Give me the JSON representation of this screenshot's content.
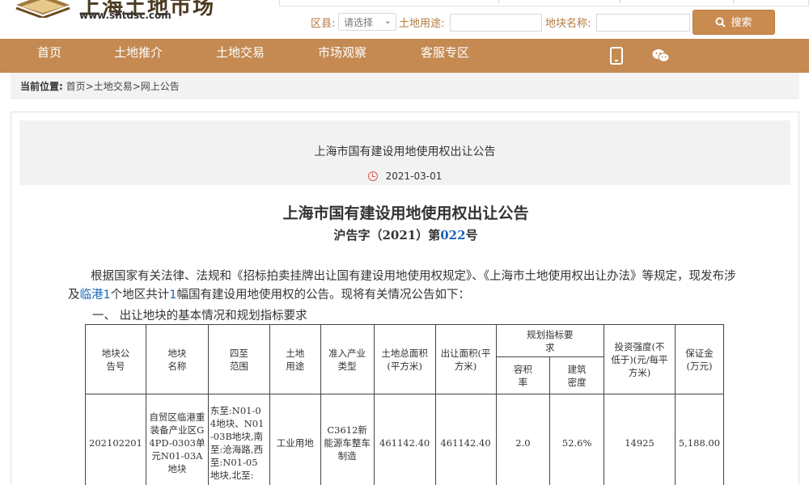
{
  "site": {
    "logo_text": "上海土地市场",
    "url": "www.shtdsc.com"
  },
  "search": {
    "district_label": "区县:",
    "district_value": "请选择",
    "usage_label": "土地用途:",
    "usage_placeholder": "",
    "name_label": "地块名称:",
    "name_placeholder": "",
    "button_label": "搜索"
  },
  "nav": {
    "items": [
      "首页",
      "土地推介",
      "土地交易",
      "市场观察",
      "客服专区"
    ],
    "icons": [
      "mobile-icon",
      "wechat-icon"
    ]
  },
  "breadcrumb": {
    "label": "当前位置:",
    "path": "首页>土地交易>网上公告"
  },
  "notice": {
    "title": "上海市国有建设用地使用权出让公告",
    "date": "2021-03-01",
    "doc_title": "上海市国有建设用地使用权出让公告",
    "doc_no_prefix": "沪告字（2021）第",
    "doc_no_num": "022",
    "doc_no_suffix": "号",
    "para_1": "根据国家有关法律、法规和《招标拍卖挂牌出让国有建设用地使用权规定》、《上海市土地使用权出让办法》等规定，现发布涉及",
    "para_hl_1": "临港1",
    "para_2": "个地区共计",
    "para_hl_2": "1",
    "para_3": "幅国有建设用地使用权的公告。现将有关情况公告如下：",
    "section_1": "一、 出让地块的基本情况和规划指标要求"
  },
  "table": {
    "headers": {
      "code": "地块公告号",
      "name": "地块名称",
      "bounds": "四至范围",
      "usage": "土地用途",
      "industry": "准入产业类型",
      "total_area": "土地总面积(平方米)",
      "sale_area": "出让面积(平方米)",
      "plan": "规划指标要求",
      "far": "容积率",
      "density": "建筑密度",
      "invest": "投资强度(不低于)(元/每平方米)",
      "deposit": "保证金(万元)"
    },
    "rows": [
      {
        "code": "202102201",
        "name": "自贸区临港重装备产业区G4PD-0303单元N01-03A地块",
        "bounds": "东至:N01-04地块、N01-03B地块,南至:沧海路,西至:N01-05地块,北至:",
        "usage": "工业用地",
        "industry": "C3612新能源车整车制造",
        "total_area": "461142.40",
        "sale_area": "461142.40",
        "far": "2.0",
        "density": "52.6%",
        "invest": "14925",
        "deposit": "5,188.00"
      }
    ]
  },
  "colors": {
    "nav_bg": "#c48a52",
    "button_bg": "#c98b50",
    "label_color": "#b5773f",
    "highlight": "#1a64b8",
    "clock": "#d9534f"
  }
}
